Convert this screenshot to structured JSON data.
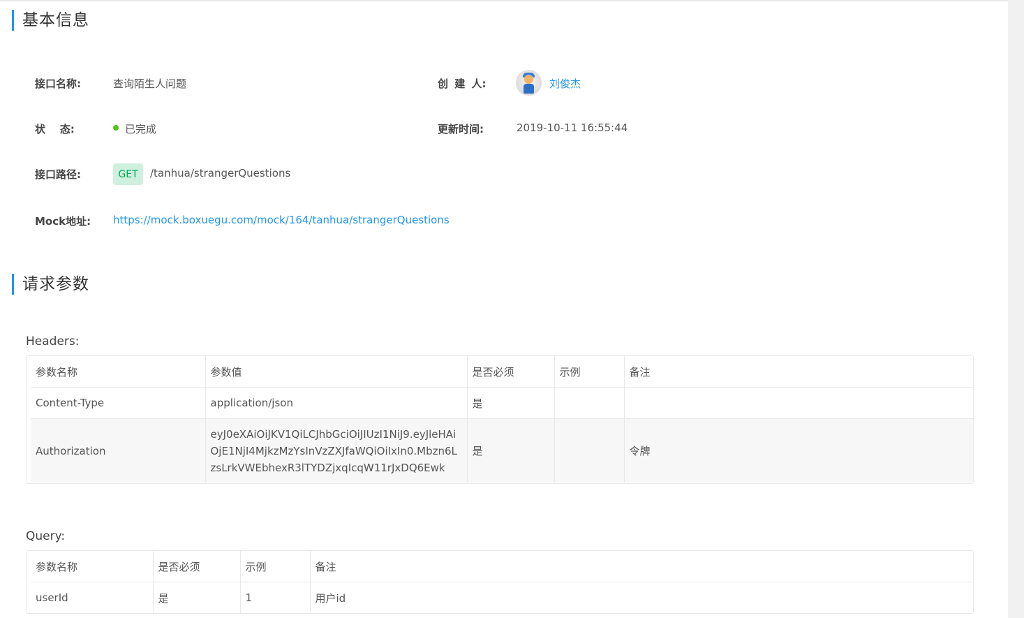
{
  "basic_info": {
    "title": "基本信息",
    "name_label": "接口名称:",
    "name_value": "查询陌生人问题",
    "creator_label": "创 建 人:",
    "creator_name": "刘俊杰",
    "status_label": "状    态:",
    "status_value": "已完成",
    "status_color": "#52c41a",
    "updated_label": "更新时间:",
    "updated_value": "2019-10-11 16:55:44",
    "path_label": "接口路径:",
    "method": "GET",
    "path_value": "/tanhua/strangerQuestions",
    "mock_label": "Mock地址:",
    "mock_url": "https://mock.boxuegu.com/mock/164/tanhua/strangerQuestions"
  },
  "request_params": {
    "title": "请求参数",
    "headers": {
      "label": "Headers:",
      "columns": [
        "参数名称",
        "参数值",
        "是否必须",
        "示例",
        "备注"
      ],
      "rows": [
        [
          "Content-Type",
          "application/json",
          "是",
          "",
          ""
        ],
        [
          "Authorization",
          "eyJ0eXAiOiJKV1QiLCJhbGciOiJIUzI1NiJ9.eyJleHAiOjE1NjI4MjkzMzYsInVzZXJfaWQiOiIxIn0.Mbzn6LzsLrkVWEbhexR3lTYDZjxqIcqW11rJxDQ6Ewk",
          "是",
          "",
          "令牌"
        ]
      ]
    },
    "query": {
      "label": "Query:",
      "columns": [
        "参数名称",
        "是否必须",
        "示例",
        "备注"
      ],
      "rows": [
        [
          "userId",
          "是",
          "1",
          "用户id"
        ]
      ]
    }
  },
  "colors": {
    "accent": "#2395f1",
    "method_bg": "#cfefdf",
    "method_text": "#00a854"
  }
}
